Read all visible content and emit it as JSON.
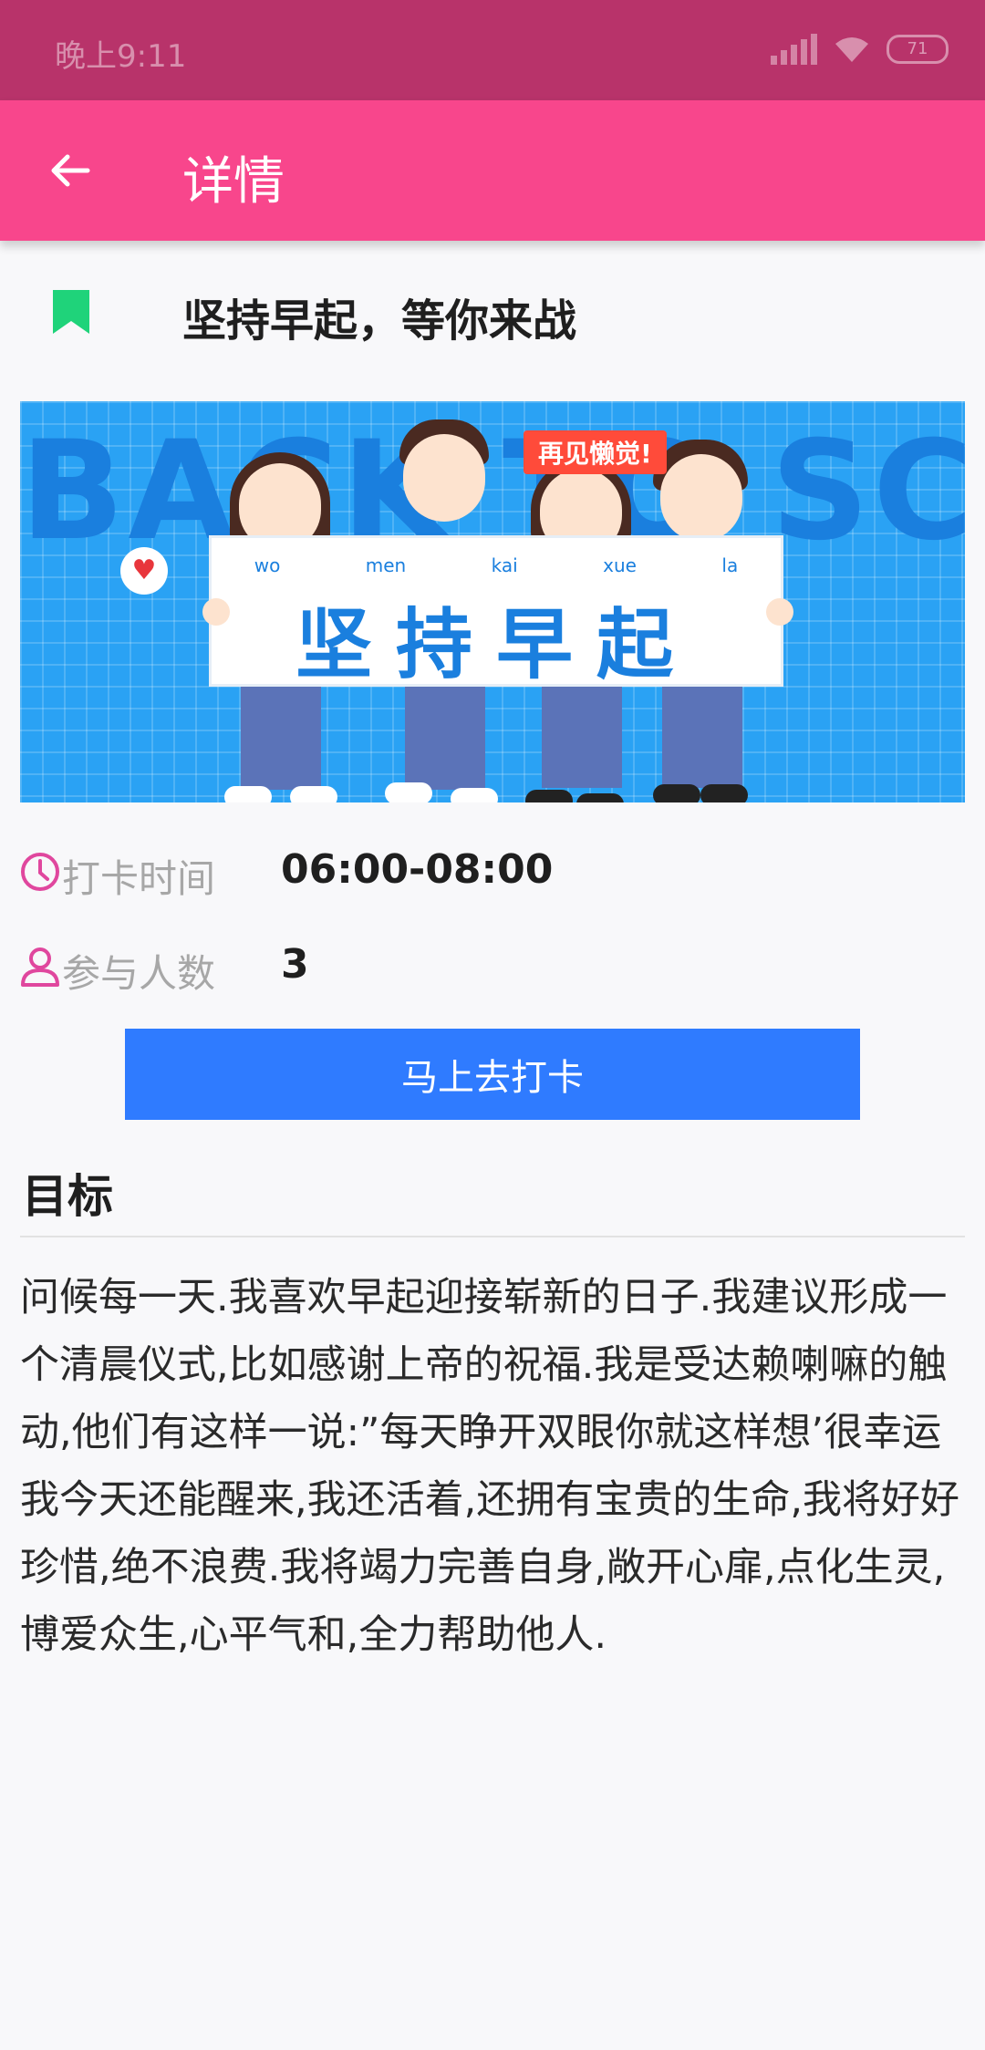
{
  "status_bar": {
    "time": "晚上9:11",
    "battery": "71"
  },
  "toolbar": {
    "title": "详情"
  },
  "headline": {
    "text": "坚持早起，等你来战",
    "icon_color": "#1fd37a"
  },
  "banner": {
    "background_text": "BACK TO SCHOOL",
    "tag": "再见懒觉!",
    "pinyin": [
      "wo",
      "men",
      "kai",
      "xue",
      "la"
    ],
    "sign_text": "坚持早起"
  },
  "info": {
    "time_label": "打卡时间",
    "time_value": "06:00-08:00",
    "participants_label": "参与人数",
    "participants_value": "3",
    "icon_color": "#e0479e"
  },
  "checkin_button": {
    "label": "马上去打卡",
    "color": "#2f7bff"
  },
  "goal": {
    "title": "目标",
    "body": "问候每一天.我喜欢早起迎接崭新的日子.我建议形成一个清晨仪式,比如感谢上帝的祝福.我是受达赖喇嘛的触动,他们有这样一说:”每天睁开双眼你就这样想’很幸运我今天还能醒来,我还活着,还拥有宝贵的生命,我将好好珍惜,绝不浪费.我将竭力完善自身,敞开心扉,点化生灵,博爱众生,心平气和,全力帮助他人."
  },
  "colors": {
    "status_bar": "#b8336a",
    "toolbar": "#f8468c",
    "background": "#f8f8fa"
  }
}
